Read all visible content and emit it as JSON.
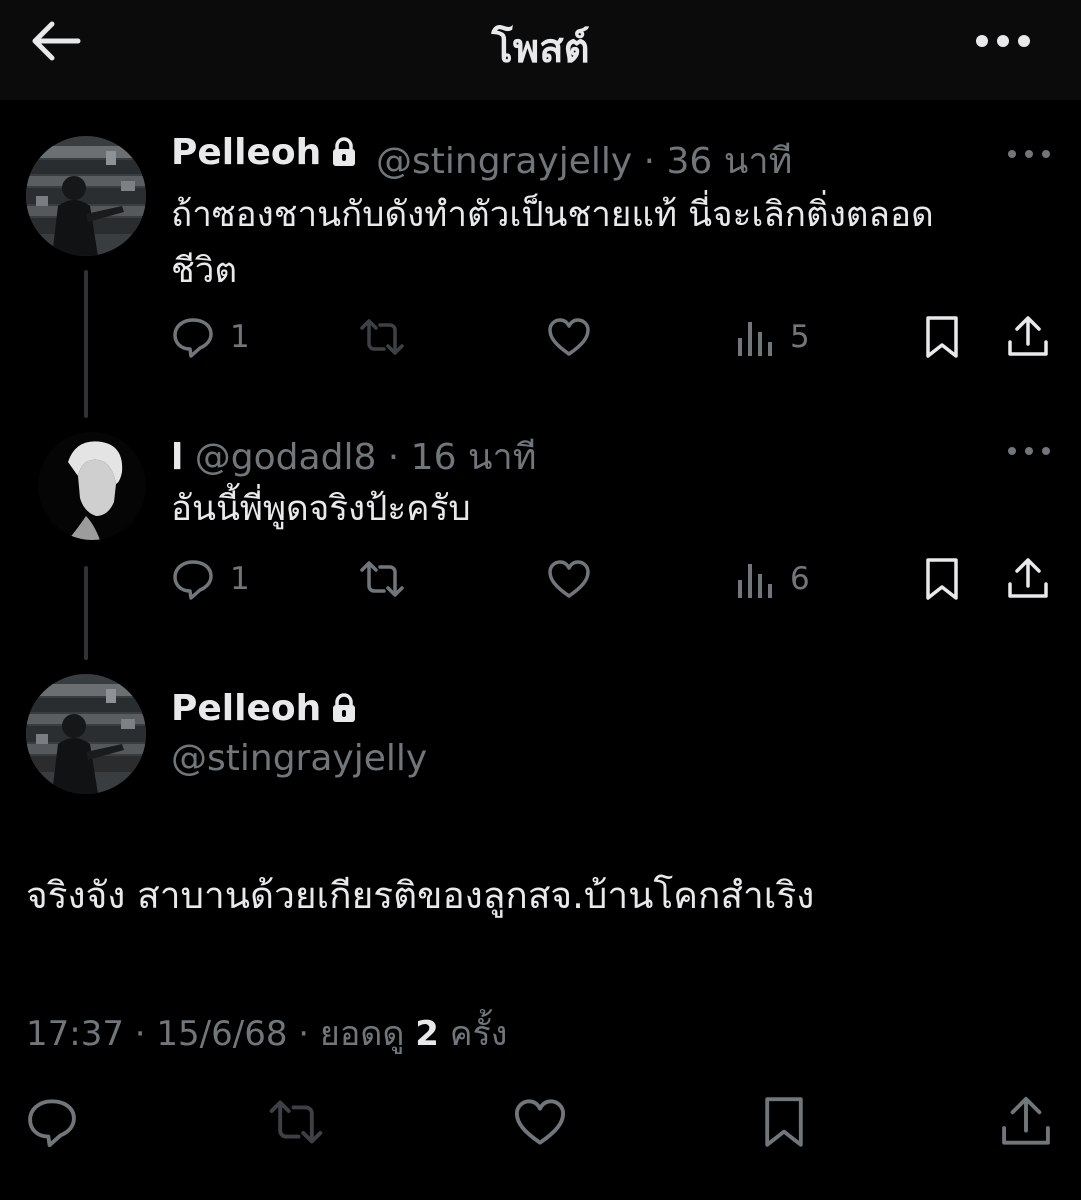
{
  "header": {
    "title": "โพสต์"
  },
  "tweet1": {
    "name": "Pelleoh",
    "handle": "@stingrayjelly",
    "time": "· 36 นาที",
    "text_line1": "ถ้าซองชานกับดังทำตัวเป็นชายแท้ นี่จะเลิกติ่งตลอด",
    "text_line2": "ชีวิต",
    "replies": "1",
    "views": "5"
  },
  "tweet2": {
    "name": "l",
    "handle": "@godadl8",
    "time": "· 16 นาที",
    "text": "อันนี้พี่พูดจริงป้ะครับ",
    "replies": "1",
    "views": "6"
  },
  "main": {
    "name": "Pelleoh",
    "handle": "@stingrayjelly",
    "text": "จริงจัง สาบานด้วยเกียรติของลูกสจ.บ้านโคกสำเริง",
    "timestamp_prefix": "17:37 · 15/6/68 · ยอดดู ",
    "view_count": "2",
    "timestamp_suffix": " ครั้ง"
  },
  "colors": {
    "background": "#000000",
    "header_bg": "#0b0b0b",
    "text_primary": "#e7e9ea",
    "text_secondary": "#71767b",
    "thread_line": "#2f3336"
  },
  "icons": [
    "back-arrow-icon",
    "more-icon",
    "lock-icon",
    "reply-icon",
    "retweet-icon",
    "like-icon",
    "views-icon",
    "bookmark-icon",
    "share-icon"
  ]
}
